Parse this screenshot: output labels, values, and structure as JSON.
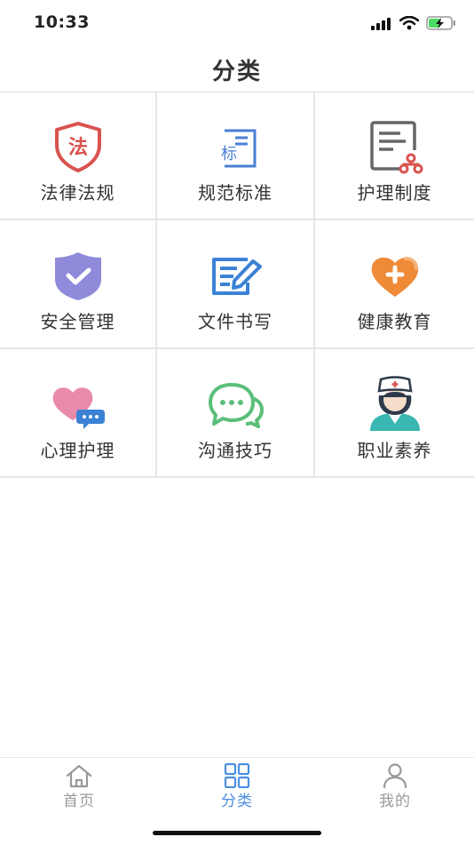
{
  "status_bar": {
    "time": "10:33"
  },
  "nav": {
    "title": "分类"
  },
  "categories": [
    {
      "label": "法律法规",
      "icon": "law-shield-icon",
      "icon_text": "法",
      "color": "#d9534f"
    },
    {
      "label": "规范标准",
      "icon": "standard-document-icon",
      "icon_text": "标",
      "color": "#4a7fd4"
    },
    {
      "label": "护理制度",
      "icon": "system-document-icon",
      "color": "#666666"
    },
    {
      "label": "安全管理",
      "icon": "safety-shield-icon",
      "color": "#8f8ad9"
    },
    {
      "label": "文件书写",
      "icon": "document-writing-icon",
      "color": "#3b82d6"
    },
    {
      "label": "健康教育",
      "icon": "health-heart-icon",
      "color": "#ef8a36"
    },
    {
      "label": "心理护理",
      "icon": "heart-chat-icon",
      "color": "#e98aab"
    },
    {
      "label": "沟通技巧",
      "icon": "chat-bubbles-icon",
      "color": "#5bbf7a"
    },
    {
      "label": "职业素养",
      "icon": "nurse-icon",
      "color": "#3ab7b2"
    }
  ],
  "tabs": [
    {
      "label": "首页",
      "icon": "home-icon",
      "active": false
    },
    {
      "label": "分类",
      "icon": "grid-icon",
      "active": true
    },
    {
      "label": "我的",
      "icon": "person-icon",
      "active": false
    }
  ],
  "colors": {
    "accent": "#4a8fe0",
    "inactive": "#999999",
    "divider": "#e6e6e6"
  }
}
